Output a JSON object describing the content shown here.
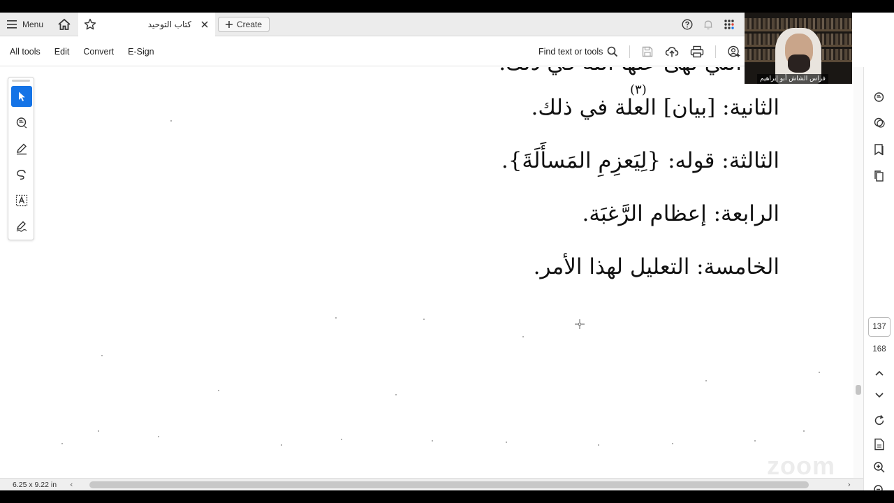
{
  "tabbar": {
    "menu_label": "Menu",
    "document_tab_title": "كتاب التوحيد",
    "create_label": "Create",
    "icons": [
      "hamburger-icon",
      "home-icon",
      "star-icon",
      "close-icon",
      "plus-icon",
      "help-icon",
      "bell-icon",
      "apps-grid-icon"
    ]
  },
  "toolbar": {
    "items": [
      "All tools",
      "Edit",
      "Convert",
      "E-Sign"
    ],
    "find_label": "Find text or tools"
  },
  "webcam": {
    "name": "فراس الشاش أبو إبراهيم"
  },
  "document": {
    "lines": [
      "التي نهى عنها الله في ذلك.",
      "الثانية: [بيان] العلة في ذلك.",
      "الثالثة: قوله: {لِيَعزِمِ المَسأَلَةَ}.",
      "الرابعة: إعظام الرَّغبَة.",
      "الخامسة: التعليل لهذا الأمر."
    ],
    "footnote_marker": "(٣)"
  },
  "navigation": {
    "current_page": "137",
    "total_pages": "168"
  },
  "status": {
    "page_size": "6.25 x 9.22 in"
  },
  "watermark": "zoom",
  "colors": {
    "accent": "#1473e6",
    "tabbar_bg": "#ececec"
  }
}
